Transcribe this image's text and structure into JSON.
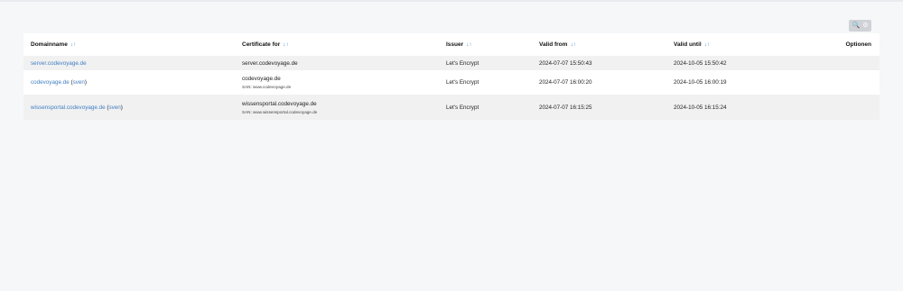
{
  "toolbar": {
    "search_icon": "search-icon",
    "settings_icon": "gear-icon",
    "search_glyph": "🔍",
    "gear_glyph": "⚙"
  },
  "table": {
    "headers": {
      "domain": "Domainname",
      "certificate": "Certificate for",
      "issuer": "Issuer",
      "valid_from": "Valid from",
      "valid_until": "Valid until",
      "options": "Optionen",
      "sort_glyph": "↓↑"
    },
    "rows": [
      {
        "domain": "server.codevoyage.de",
        "owner": "",
        "certificate": "server.codevoyage.de",
        "san": "",
        "issuer": "Let's Encrypt",
        "valid_from": "2024-07-07 15:50:43",
        "valid_until": "2024-10-05 15:50:42"
      },
      {
        "domain": "codevoyage.de",
        "owner": "sven",
        "certificate": "codevoyage.de",
        "san": "SAN: www.codevoyage.de",
        "issuer": "Let's Encrypt",
        "valid_from": "2024-07-07 16:00:20",
        "valid_until": "2024-10-05 16:00:19"
      },
      {
        "domain": "wissensportal.codevoyage.de",
        "owner": "sven",
        "certificate": "wissensportal.codevoyage.de",
        "san": "SAN: www.wissensportal.codevoyage.de",
        "issuer": "Let's Encrypt",
        "valid_from": "2024-07-07 16:15:25",
        "valid_until": "2024-10-05 16:15:24"
      }
    ]
  }
}
